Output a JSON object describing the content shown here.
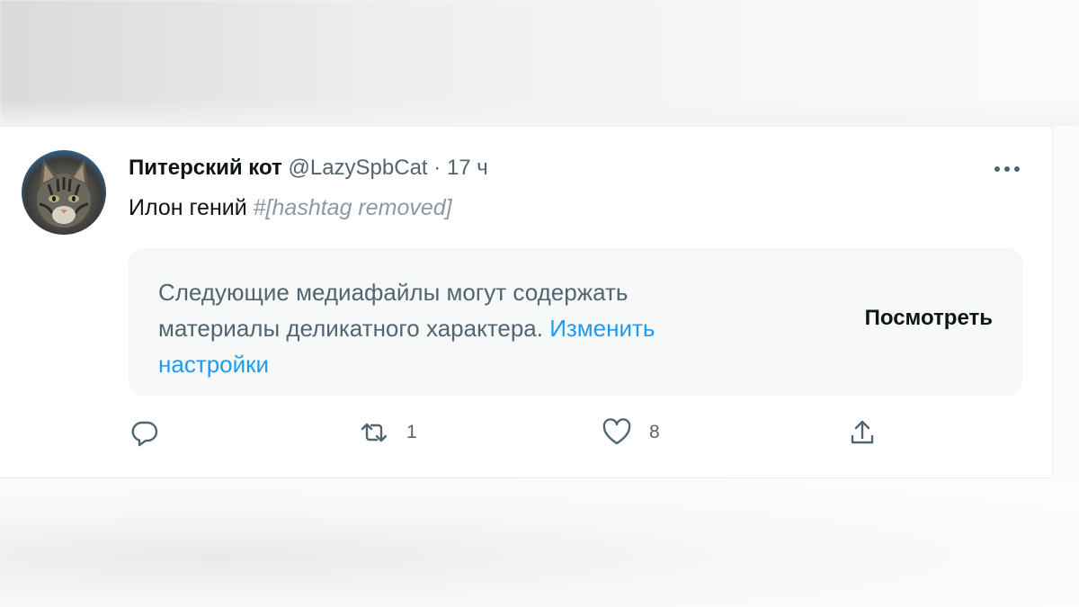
{
  "tweet": {
    "author": {
      "display_name": "Питерский кот",
      "handle": "@LazySpbCat",
      "separator": "·",
      "time": "17 ч"
    },
    "text": "Илон гений",
    "hashtag": "#[hashtag removed]",
    "media_warning": {
      "message": "Следующие медиафайлы могут содержать материалы деликатного характера.",
      "settings_link": "Изменить настройки",
      "view_button": "Посмотреть"
    },
    "actions": {
      "reply": {
        "icon": "reply-icon",
        "count": ""
      },
      "retweet": {
        "icon": "retweet-icon",
        "count": "1"
      },
      "like": {
        "icon": "heart-icon",
        "count": "8"
      },
      "share": {
        "icon": "share-icon"
      }
    }
  },
  "colors": {
    "text": "#0f1419",
    "secondary": "#536471",
    "link": "#1d9bf0"
  }
}
